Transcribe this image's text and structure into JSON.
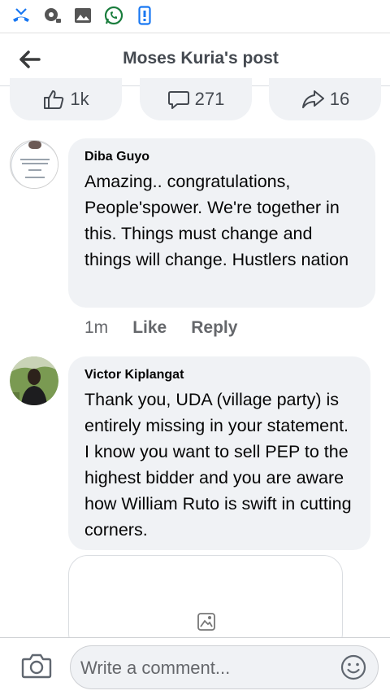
{
  "header": {
    "title": "Moses Kuria's post"
  },
  "reactions": {
    "likes": "1k",
    "comments": "271",
    "shares": "16"
  },
  "comments": [
    {
      "author": "Diba Guyo",
      "text": "Amazing.. congratulations, People'spower. We're together in this. Things must change and things will change. Hustlers nation",
      "time": "1m",
      "like_label": "Like",
      "reply_label": "Reply"
    },
    {
      "author": "Victor Kiplangat",
      "text": "Thank you, UDA  (village party) is entirely missing in your statement.  I know you want to sell PEP to the highest bidder and you are aware how William Ruto is swift in cutting corners."
    }
  ],
  "composer": {
    "placeholder": "Write a comment..."
  },
  "icons": {
    "status": [
      "missed-call-icon",
      "media-icon",
      "gallery-icon",
      "whatsapp-icon",
      "phone-icon"
    ],
    "back": "back-arrow-icon",
    "like": "thumbs-up-icon",
    "comment": "comment-bubble-icon",
    "share": "share-arrow-icon",
    "camera": "camera-icon",
    "emoji": "emoji-icon",
    "attachment": "image-placeholder-icon"
  },
  "colors": {
    "accent": "#1877f2",
    "bubble": "#f0f2f5",
    "secondary_text": "#65676b",
    "whatsapp": "#25d366"
  }
}
